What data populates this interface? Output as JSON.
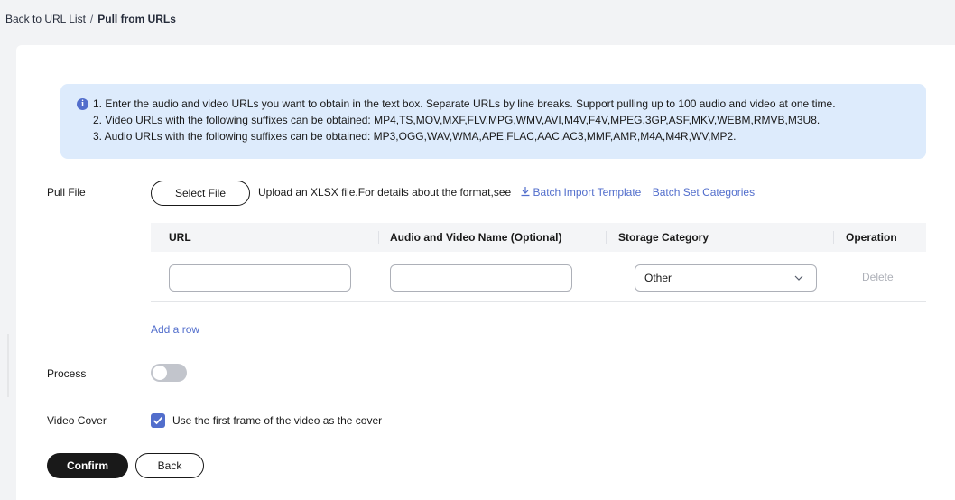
{
  "breadcrumb": {
    "back_link": "Back to URL List",
    "separator": "/",
    "current": "Pull from URLs"
  },
  "info": {
    "icon": "info-icon",
    "lines": [
      "1. Enter the audio and video URLs you want to obtain in the text box. Separate URLs by line breaks. Support pulling up to 100 audio and video at one time.",
      "2. Video URLs with the following suffixes can be obtained: MP4,TS,MOV,MXF,FLV,MPG,WMV,AVI,M4V,F4V,MPEG,3GP,ASF,MKV,WEBM,RMVB,M3U8.",
      "3. Audio URLs with the following suffixes can be obtained: MP3,OGG,WAV,WMA,APE,FLAC,AAC,AC3,MMF,AMR,M4A,M4R,WV,MP2."
    ]
  },
  "pull_file": {
    "label": "Pull File",
    "select_button": "Select File",
    "upload_text": "Upload an XLSX file.For details about the format,see",
    "template_link": "Batch Import Template",
    "categories_link": "Batch Set Categories"
  },
  "table": {
    "columns": [
      "URL",
      "Audio and Video Name (Optional)",
      "Storage Category",
      "Operation"
    ],
    "rows": [
      {
        "url": "",
        "name": "",
        "storage_category": "Other",
        "operation": "Delete"
      }
    ],
    "add_row": "Add a row"
  },
  "process": {
    "label": "Process",
    "enabled": false
  },
  "video_cover": {
    "label": "Video Cover",
    "checked": true,
    "checkbox_label": "Use the first frame of the video as the cover"
  },
  "actions": {
    "confirm": "Confirm",
    "back": "Back"
  },
  "colors": {
    "accent": "#526ecc",
    "info_background": "#ddebfc",
    "primary_button": "#191919",
    "page_background": "#f2f3f5"
  }
}
